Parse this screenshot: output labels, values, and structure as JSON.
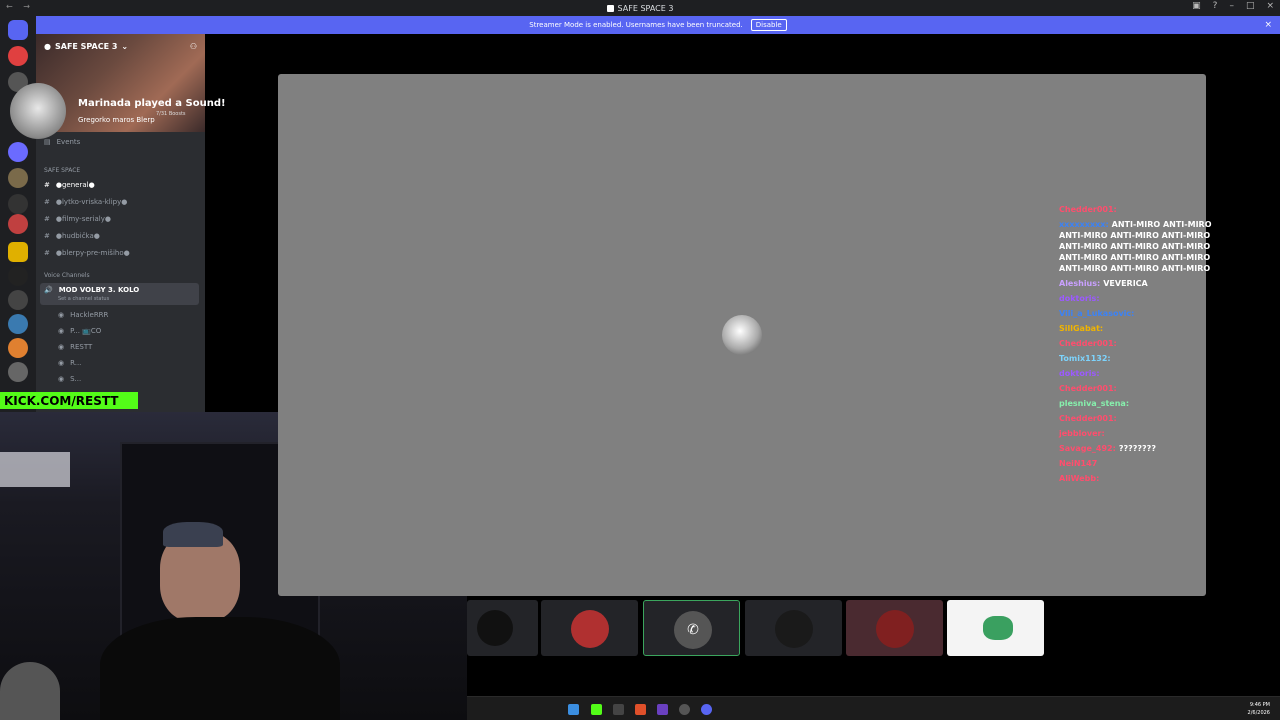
{
  "window": {
    "title": "SAFE SPACE 3",
    "nav": "← →"
  },
  "banner": {
    "text": "Streamer Mode is enabled. Usernames have been truncated.",
    "button": "Disable",
    "close": "×"
  },
  "server": {
    "name": "SAFE SPACE 3",
    "sound_notice": "Marinada played a Sound!",
    "sound_sub": "Gregorko maros Blerp",
    "boosts": "7/31 Boosts",
    "events": "Events",
    "category": "SAFE SPACE",
    "channels": [
      {
        "name": "●general●",
        "active": true
      },
      {
        "name": "●lytko-vriska-klipy●"
      },
      {
        "name": "●filmy-serialy●"
      },
      {
        "name": "●hudbička●"
      },
      {
        "name": "●blerpy-pre-mišiho●"
      }
    ],
    "voice_category": "Voice Channels",
    "voice_channel": "MOD VOLBY 3. KOLO",
    "voice_status": "Set a channel status",
    "voice_users": [
      "HackleRRR",
      "P... 📺CO",
      "RESTT",
      "R...",
      "S..."
    ]
  },
  "overlay": {
    "kick": "KICK.COM/RESTT"
  },
  "chat": [
    {
      "user": "Chedder001:",
      "text": "",
      "color": "#ff4d6d"
    },
    {
      "user": "xxxxxxxxx:",
      "text": "ANTI-MIRO ANTI-MIRO ANTI-MIRO ANTI-MIRO ANTI-MIRO ANTI-MIRO ANTI-MIRO ANTI-MIRO ANTI-MIRO ANTI-MIRO ANTI-MIRO ANTI-MIRO ANTI-MIRO ANTI-MIRO",
      "color": "#3b82f6"
    },
    {
      "user": "Aleshius:",
      "text": "VEVERICA",
      "color": "#c9a0ff"
    },
    {
      "user": "doktoris:",
      "text": "",
      "color": "#9b59ff"
    },
    {
      "user": "Vili_a_Lukasovic:",
      "text": "",
      "color": "#3b82f6"
    },
    {
      "user": "SillGabat:",
      "text": "",
      "color": "#f0b400"
    },
    {
      "user": "Chedder001:",
      "text": "",
      "color": "#ff4d6d"
    },
    {
      "user": "Tomix1132:",
      "text": "",
      "color": "#7dd3fc"
    },
    {
      "user": "doktoris:",
      "text": "",
      "color": "#9b59ff"
    },
    {
      "user": "Chedder001:",
      "text": "",
      "color": "#ff4d6d"
    },
    {
      "user": "plesniva_stena:",
      "text": "",
      "color": "#86efac"
    },
    {
      "user": "Chedder001:",
      "text": "",
      "color": "#ff4d6d"
    },
    {
      "user": "jebblover:",
      "text": "",
      "color": "#ff4d6d"
    },
    {
      "user": "Savage_492:",
      "text": "????????",
      "color": "#ff4d6d"
    },
    {
      "user": "NeiN147",
      "text": "",
      "color": "#ff4d6d"
    },
    {
      "user": "AliWebb:",
      "text": "",
      "color": "#ff4d6d"
    }
  ],
  "clock": {
    "time": "9:46 PM",
    "date": "2/6/2026"
  }
}
